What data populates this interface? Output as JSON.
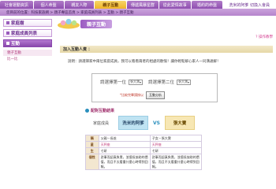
{
  "nav": {
    "tabs": [
      {
        "label": "社會運動資訊"
      },
      {
        "label": "個人命盤"
      },
      {
        "label": "親友人際"
      },
      {
        "label": "親子互動"
      },
      {
        "label": "傳遞風暴星群"
      },
      {
        "label": "從此愛情故事"
      },
      {
        "label": "婚約的命盤"
      }
    ],
    "user_link": "洗米的阿爹 切換入會員"
  },
  "breadcrumb": "您目前的位置：科技家族網 > 親子專區首頁 > 家庭成員列表 > 互動 > 親子互動",
  "sidebar": {
    "items": [
      {
        "label": "家庭樹"
      },
      {
        "label": "家庭成員列表"
      },
      {
        "label": "互動"
      }
    ],
    "sub_items": [
      {
        "label": "親子互動"
      },
      {
        "label": "比一比"
      }
    ]
  },
  "header": {
    "title": "親子互動",
    "hint": "? 操作教學"
  },
  "section": {
    "title": "加入互動人資 ："
  },
  "note": "說明：請選擇家中兩位家庭成員，我可以看看兩者的相處的歡愉！讓你輕鬆解心家人一同溝通解！",
  "picker": {
    "label_first": "請選擇第一位",
    "label_second": "請選擇第二位",
    "select_first": "張大寶",
    "select_second": "張大寶",
    "warning": "*比較完畢請按以",
    "button": "互動分析"
  },
  "result": {
    "title": "配對互動結果",
    "caption": "家庭成員",
    "member_a": "洗米的阿爹",
    "member_b": "張大寶",
    "vs": "VS"
  },
  "table": {
    "rows": [
      {
        "key": "稱",
        "a": "父親－長爸",
        "b": "子女－張大寶"
      },
      {
        "key": "星",
        "a": "天秤座",
        "b": "天秤座"
      },
      {
        "key": "生",
        "a": "七研",
        "b": "七研"
      },
      {
        "key": "個性",
        "a": "對事而認真負責，並擅長協助的價值，而且不太看重什麼心時得到回報。",
        "b": "對事而認真負責，並擅長協助的價值，而且不太看重什麼心時得到回報。"
      }
    ]
  },
  "colors": {
    "accent_purple": "#8f4fb0",
    "active_tab": "#f0b429",
    "section_bar": "#e6d7a6"
  }
}
